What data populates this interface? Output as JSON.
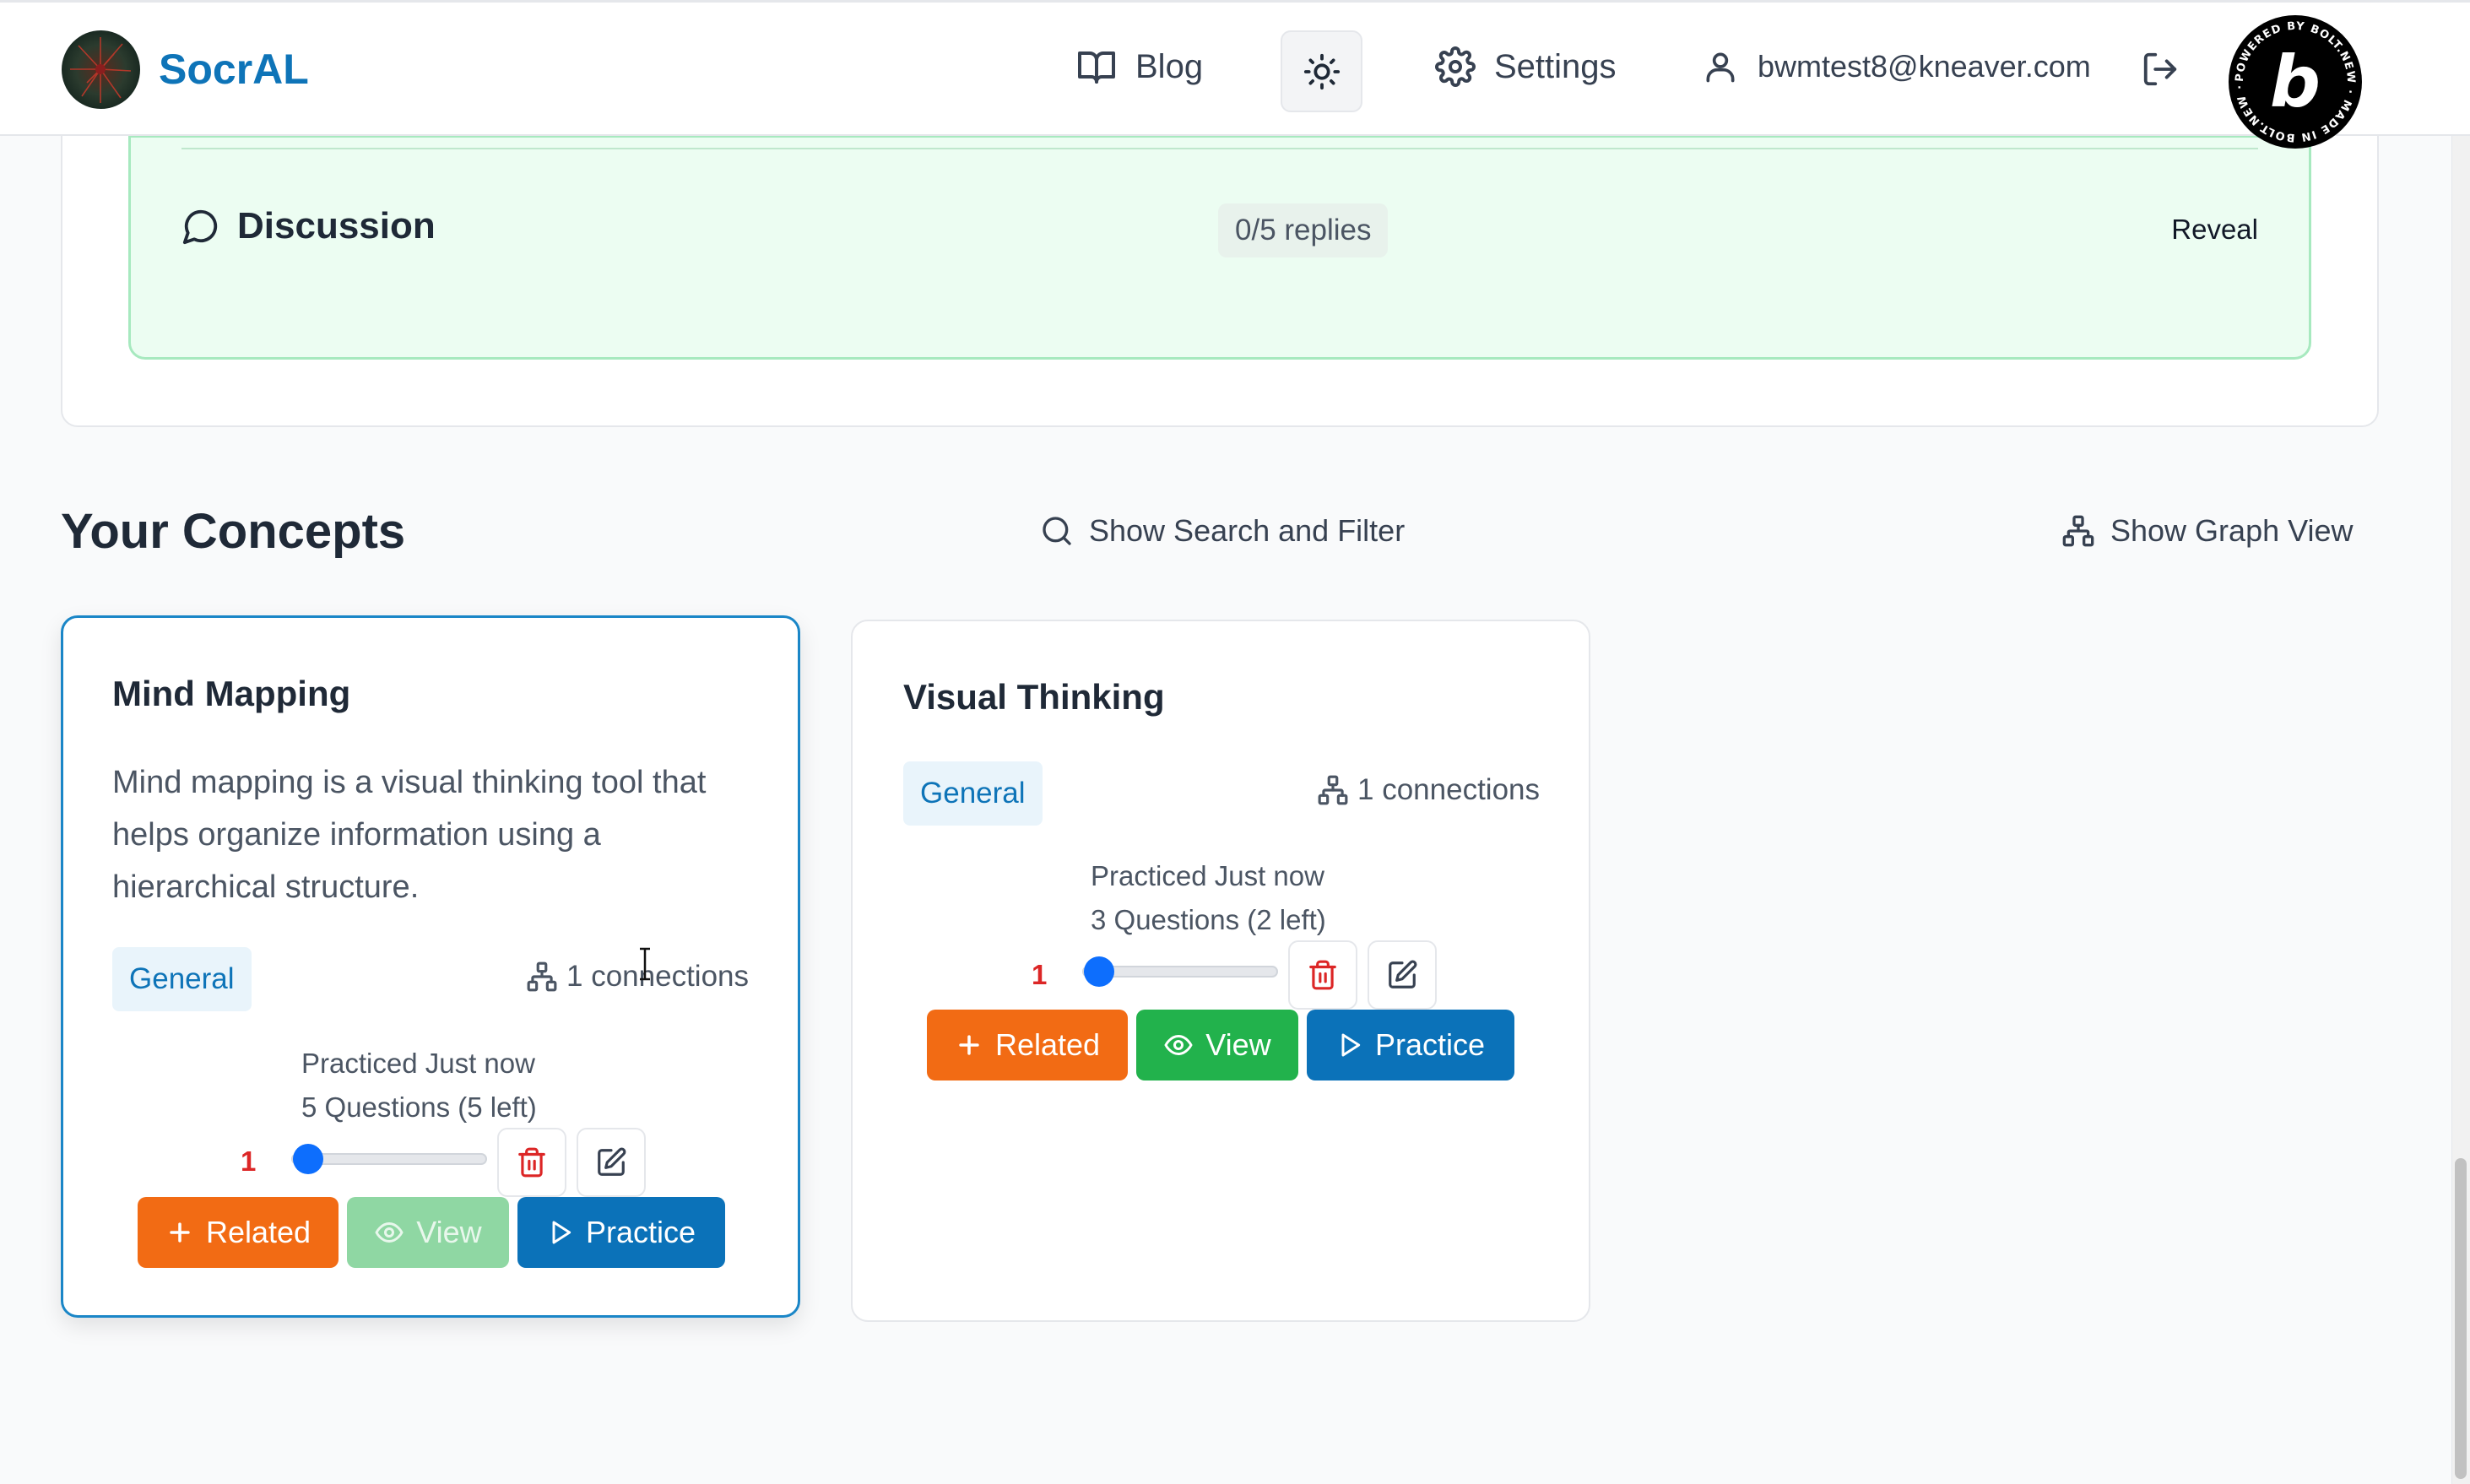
{
  "header": {
    "brand": "SocrAL",
    "nav": {
      "blog": "Blog",
      "settings": "Settings"
    },
    "user_email": "bwmtest8@kneaver.com",
    "badge_letter": "b",
    "badge_ring_text": "POWERED BY BOLT.NEW · MADE IN BOLT.NEW ·"
  },
  "discussion": {
    "title": "Discussion",
    "replies": "0/5 replies",
    "reveal": "Reveal"
  },
  "concepts": {
    "title": "Your Concepts",
    "search_toggle": "Show Search and Filter",
    "graph_toggle": "Show Graph View",
    "items": [
      {
        "title": "Mind Mapping",
        "description": "Mind mapping is a visual thinking tool that helps organize information using a hierarchical structure.",
        "tag": "General",
        "connections": "1 connections",
        "practiced": "Practiced Just now",
        "questions": "5 Questions (5 left)",
        "count": "1",
        "slider_fraction": 0.08,
        "buttons": {
          "related": "Related",
          "view": "View",
          "practice": "Practice"
        },
        "selected": true
      },
      {
        "title": "Visual Thinking",
        "description": "",
        "tag": "General",
        "connections": "1 connections",
        "practiced": "Practiced Just now",
        "questions": "3 Questions (2 left)",
        "count": "1",
        "slider_fraction": 0.08,
        "buttons": {
          "related": "Related",
          "view": "View",
          "practice": "Practice"
        },
        "selected": false
      }
    ]
  },
  "colors": {
    "brand": "#0e74b8",
    "related": "#f26b14",
    "view": "#22b24c",
    "practice": "#0b72b9",
    "count": "#dc2626",
    "slider": "#0d6efd"
  }
}
